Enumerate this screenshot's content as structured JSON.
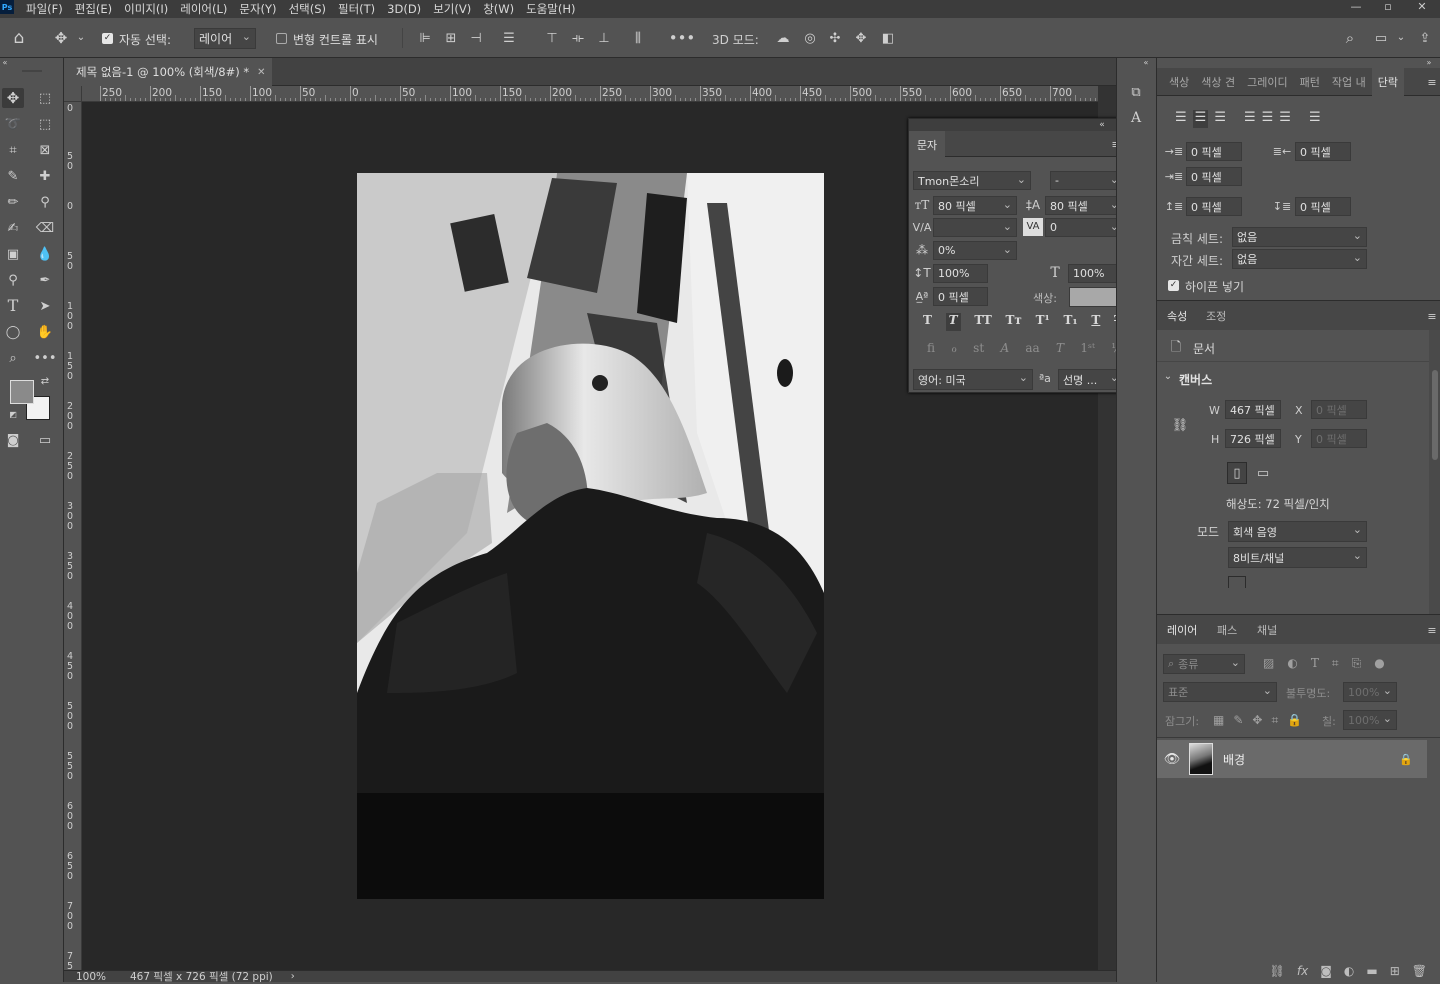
{
  "app_icon": "Ps",
  "menu": [
    "파일(F)",
    "편집(E)",
    "이미지(I)",
    "레이어(L)",
    "문자(Y)",
    "선택(S)",
    "필터(T)",
    "3D(D)",
    "보기(V)",
    "창(W)",
    "도움말(H)"
  ],
  "options": {
    "auto_select_label": "자동 선택:",
    "auto_select_value": "레이어",
    "transform_label": "변형 컨트롤 표시",
    "mode_3d_label": "3D 모드:"
  },
  "document": {
    "tab_title": "제목 없음-1 @ 100% (회색/8#) *",
    "ruler_h": [
      "250",
      "200",
      "150",
      "100",
      "50",
      "0",
      "50",
      "100",
      "150",
      "200",
      "250",
      "300",
      "350",
      "400",
      "450",
      "500",
      "550",
      "600",
      "650",
      "700"
    ],
    "ruler_v": [
      "0",
      "5\n0",
      "0",
      "5\n0",
      "1\n0\n0",
      "1\n5\n0",
      "2\n0\n0",
      "2\n5\n0",
      "3\n0\n0",
      "3\n5\n0",
      "4\n0\n0",
      "4\n5\n0",
      "5\n0\n0",
      "5\n5\n0",
      "6\n0\n0",
      "6\n5\n0",
      "7\n0\n0",
      "7\n5\n0"
    ],
    "zoom": "100%",
    "status": "467 픽셀 x 726 픽셀 (72 ppi)"
  },
  "char_panel": {
    "title": "문자",
    "font_family": "Tmon몬소리",
    "font_style": "-",
    "size": "80 픽셀",
    "leading": "80 픽셀",
    "kerning": "",
    "tracking": "0",
    "tsume": "0%",
    "vscale": "100%",
    "hscale": "100%",
    "baseline": "0 픽셀",
    "color_label": "색상:",
    "color_value": "#a8a8a8",
    "language": "영어: 미국",
    "aa_label": "ªa",
    "antialias": "선명 ..."
  },
  "top_tabs": [
    "색상",
    "색상 견",
    "그레이디",
    "패턴",
    "작업 내",
    "단락"
  ],
  "paragraph": {
    "indent_left": "0 픽셀",
    "indent_right": "0 픽셀",
    "indent_first": "0 픽셀",
    "space_before": "0 픽셀",
    "space_after": "0 픽셀",
    "kinsoku_label": "금칙 세트:",
    "kinsoku_value": "없음",
    "mojikumi_label": "자간 세트:",
    "mojikumi_value": "없음",
    "hyphen_label": "하이픈 넣기"
  },
  "properties": {
    "tabs": [
      "속성",
      "조정"
    ],
    "doc_label": "문서",
    "canvas_label": "캔버스",
    "w_label": "W",
    "w_value": "467 픽셀",
    "h_label": "H",
    "h_value": "726 픽셀",
    "x_label": "X",
    "x_placeholder": "0 픽셀",
    "y_label": "Y",
    "y_placeholder": "0 픽셀",
    "resolution": "해상도: 72 픽셀/인치",
    "mode_label": "모드",
    "mode_value": "회색 음영",
    "depth_value": "8비트/채널"
  },
  "layers": {
    "tabs": [
      "레이어",
      "패스",
      "채널"
    ],
    "filter_label": "종류",
    "blend_mode": "표준",
    "opacity_label": "불투명도:",
    "opacity_value": "100%",
    "lock_label": "잠그기:",
    "fill_label": "칠:",
    "fill_value": "100%",
    "items": [
      {
        "name": "배경"
      }
    ]
  },
  "colors": {
    "foreground": "#8a8a8a",
    "background": "#f2f2f2",
    "accent": "#2d8ceb"
  }
}
